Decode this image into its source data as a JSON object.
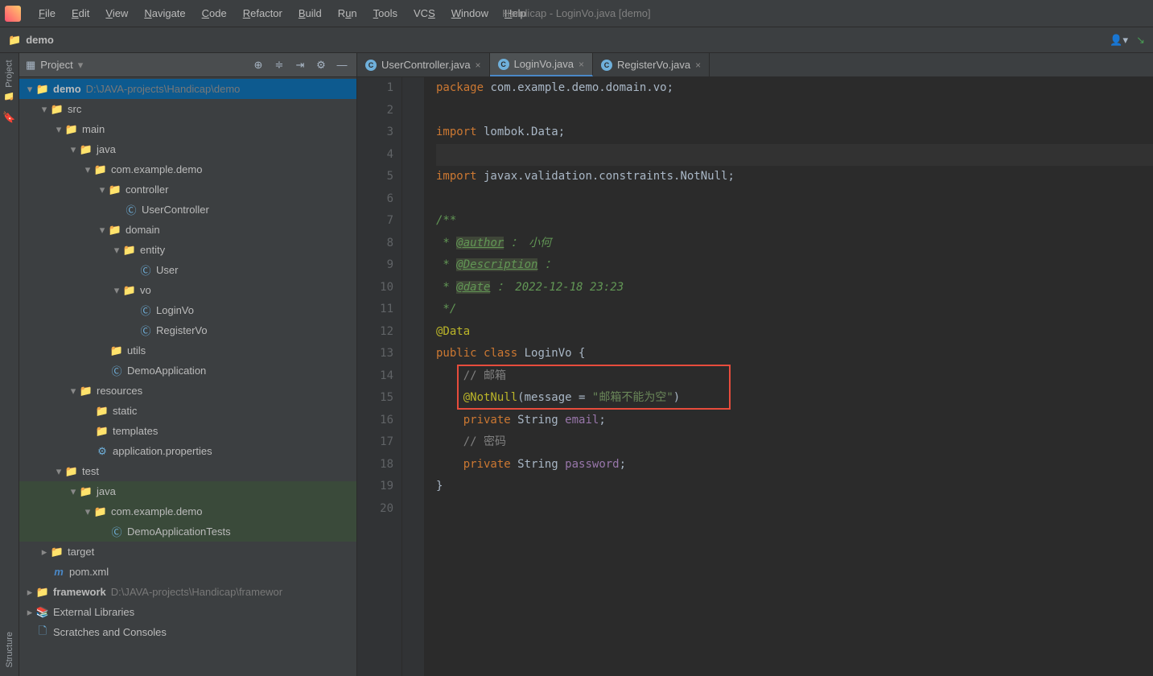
{
  "window": {
    "title": "Handicap - LoginVo.java [demo]"
  },
  "menu": {
    "file": "File",
    "edit": "Edit",
    "view": "View",
    "navigate": "Navigate",
    "code": "Code",
    "refactor": "Refactor",
    "build": "Build",
    "run": "Run",
    "tools": "Tools",
    "vcs": "VCS",
    "window": "Window",
    "help": "Help"
  },
  "breadcrumb": {
    "root": "demo"
  },
  "projectHeader": {
    "label": "Project"
  },
  "leftRail": {
    "project": "Project",
    "structure": "Structure"
  },
  "tree": {
    "demo": "demo",
    "demoPath": "D:\\JAVA-projects\\Handicap\\demo",
    "src": "src",
    "main": "main",
    "java": "java",
    "pkg": "com.example.demo",
    "controller": "controller",
    "userController": "UserController",
    "domain": "domain",
    "entity": "entity",
    "user": "User",
    "vo": "vo",
    "loginVo": "LoginVo",
    "registerVo": "RegisterVo",
    "utils": "utils",
    "demoApplication": "DemoApplication",
    "resources": "resources",
    "static": "static",
    "templates": "templates",
    "appProps": "application.properties",
    "test": "test",
    "java2": "java",
    "testPkg": "com.example.demo",
    "demoAppTests": "DemoApplicationTests",
    "target": "target",
    "pom": "pom.xml",
    "framework": "framework",
    "frameworkPath": "D:\\JAVA-projects\\Handicap\\framewor",
    "extLibs": "External Libraries",
    "scratches": "Scratches and Consoles"
  },
  "tabs": {
    "userController": "UserController.java",
    "loginVo": "LoginVo.java",
    "registerVo": "RegisterVo.java"
  },
  "code": {
    "lines": [
      "1",
      "2",
      "3",
      "4",
      "5",
      "6",
      "7",
      "8",
      "9",
      "10",
      "11",
      "12",
      "13",
      "14",
      "15",
      "16",
      "17",
      "18",
      "19",
      "20"
    ],
    "l1_kw": "package",
    "l1_rest": " com.example.demo.domain.vo;",
    "l3_kw": "import",
    "l3_id": " lombok.",
    "l3_cls": "Data",
    "l3_end": ";",
    "l5_kw": "import",
    "l5_id": " javax.validation.constraints.",
    "l5_cls": "NotNull",
    "l5_end": ";",
    "l7": "/**",
    "l8_star": " * ",
    "l8_tag": "@author",
    "l8_rest": " ： 小何",
    "l9_star": " * ",
    "l9_tag": "@Description",
    "l9_rest": " ：",
    "l10_star": " * ",
    "l10_tag": "@date",
    "l10_rest": " ： 2022-12-18 23:23",
    "l11": " */",
    "l12": "@Data",
    "l13_pub": "public ",
    "l13_cls": "class ",
    "l13_name": "LoginVo ",
    "l13_brace": "{",
    "l14_cmt": "// 邮箱",
    "l15_ann": "@NotNull",
    "l15_open": "(",
    "l15_msg": "message",
    "l15_eq": " = ",
    "l15_str": "\"邮箱不能为空\"",
    "l15_close": ")",
    "l16_priv": "private ",
    "l16_type": "String ",
    "l16_field": "email",
    "l16_semi": ";",
    "l17_cmt": "// 密码",
    "l18_priv": "private ",
    "l18_type": "String ",
    "l18_field": "password",
    "l18_semi": ";",
    "l19": "}"
  }
}
